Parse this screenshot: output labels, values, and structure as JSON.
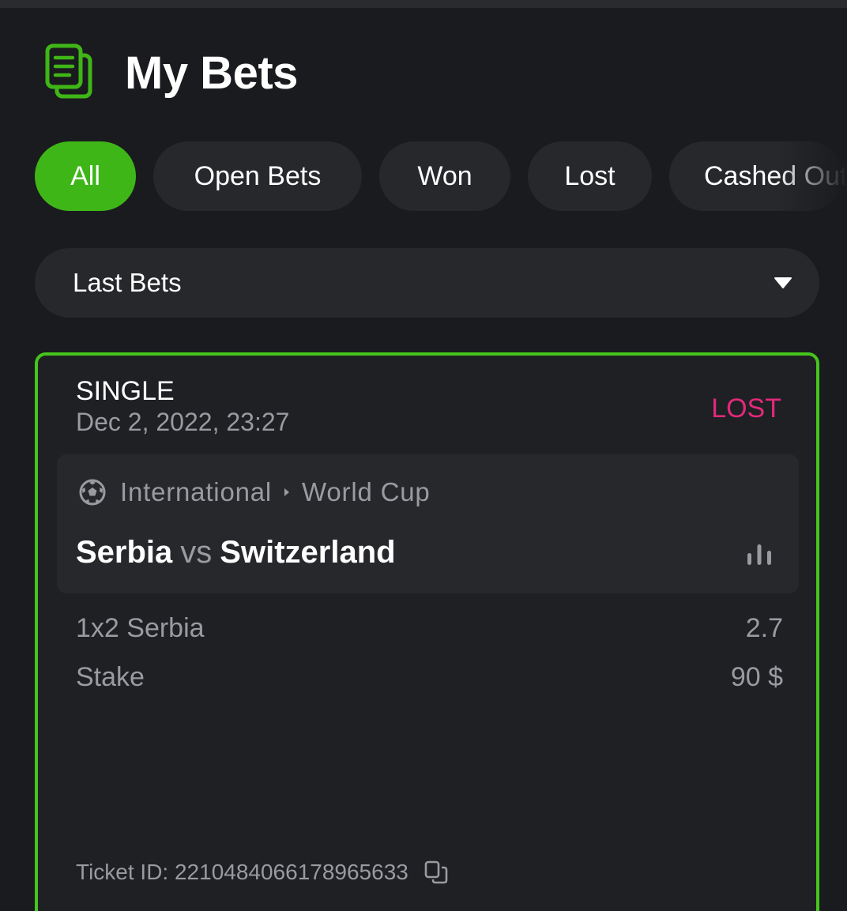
{
  "header": {
    "title": "My Bets",
    "icon": "bets-document-icon",
    "accent": "#3fb618"
  },
  "filters": [
    {
      "label": "All",
      "active": true
    },
    {
      "label": "Open Bets",
      "active": false
    },
    {
      "label": "Won",
      "active": false
    },
    {
      "label": "Lost",
      "active": false
    },
    {
      "label": "Cashed Out",
      "active": false
    }
  ],
  "dropdown": {
    "selected": "Last Bets",
    "icon": "caret-down-icon"
  },
  "bet": {
    "type": "SINGLE",
    "date": "Dec 2, 2022, 23:27",
    "status": "LOST",
    "status_color": "#e2297a",
    "border_color": "#46c51d",
    "event": {
      "sport_icon": "soccer-ball-icon",
      "category": "International",
      "league": "World Cup",
      "home": "Serbia",
      "vs": "vs",
      "away": "Switzerland",
      "stats_icon": "stats-icon"
    },
    "selection": {
      "label": "1x2 Serbia",
      "odds": "2.7"
    },
    "stake": {
      "label": "Stake",
      "value": "90 $"
    },
    "ticket": {
      "label": "Ticket ID: 2210484066178965633",
      "icon": "copy-icon"
    }
  }
}
